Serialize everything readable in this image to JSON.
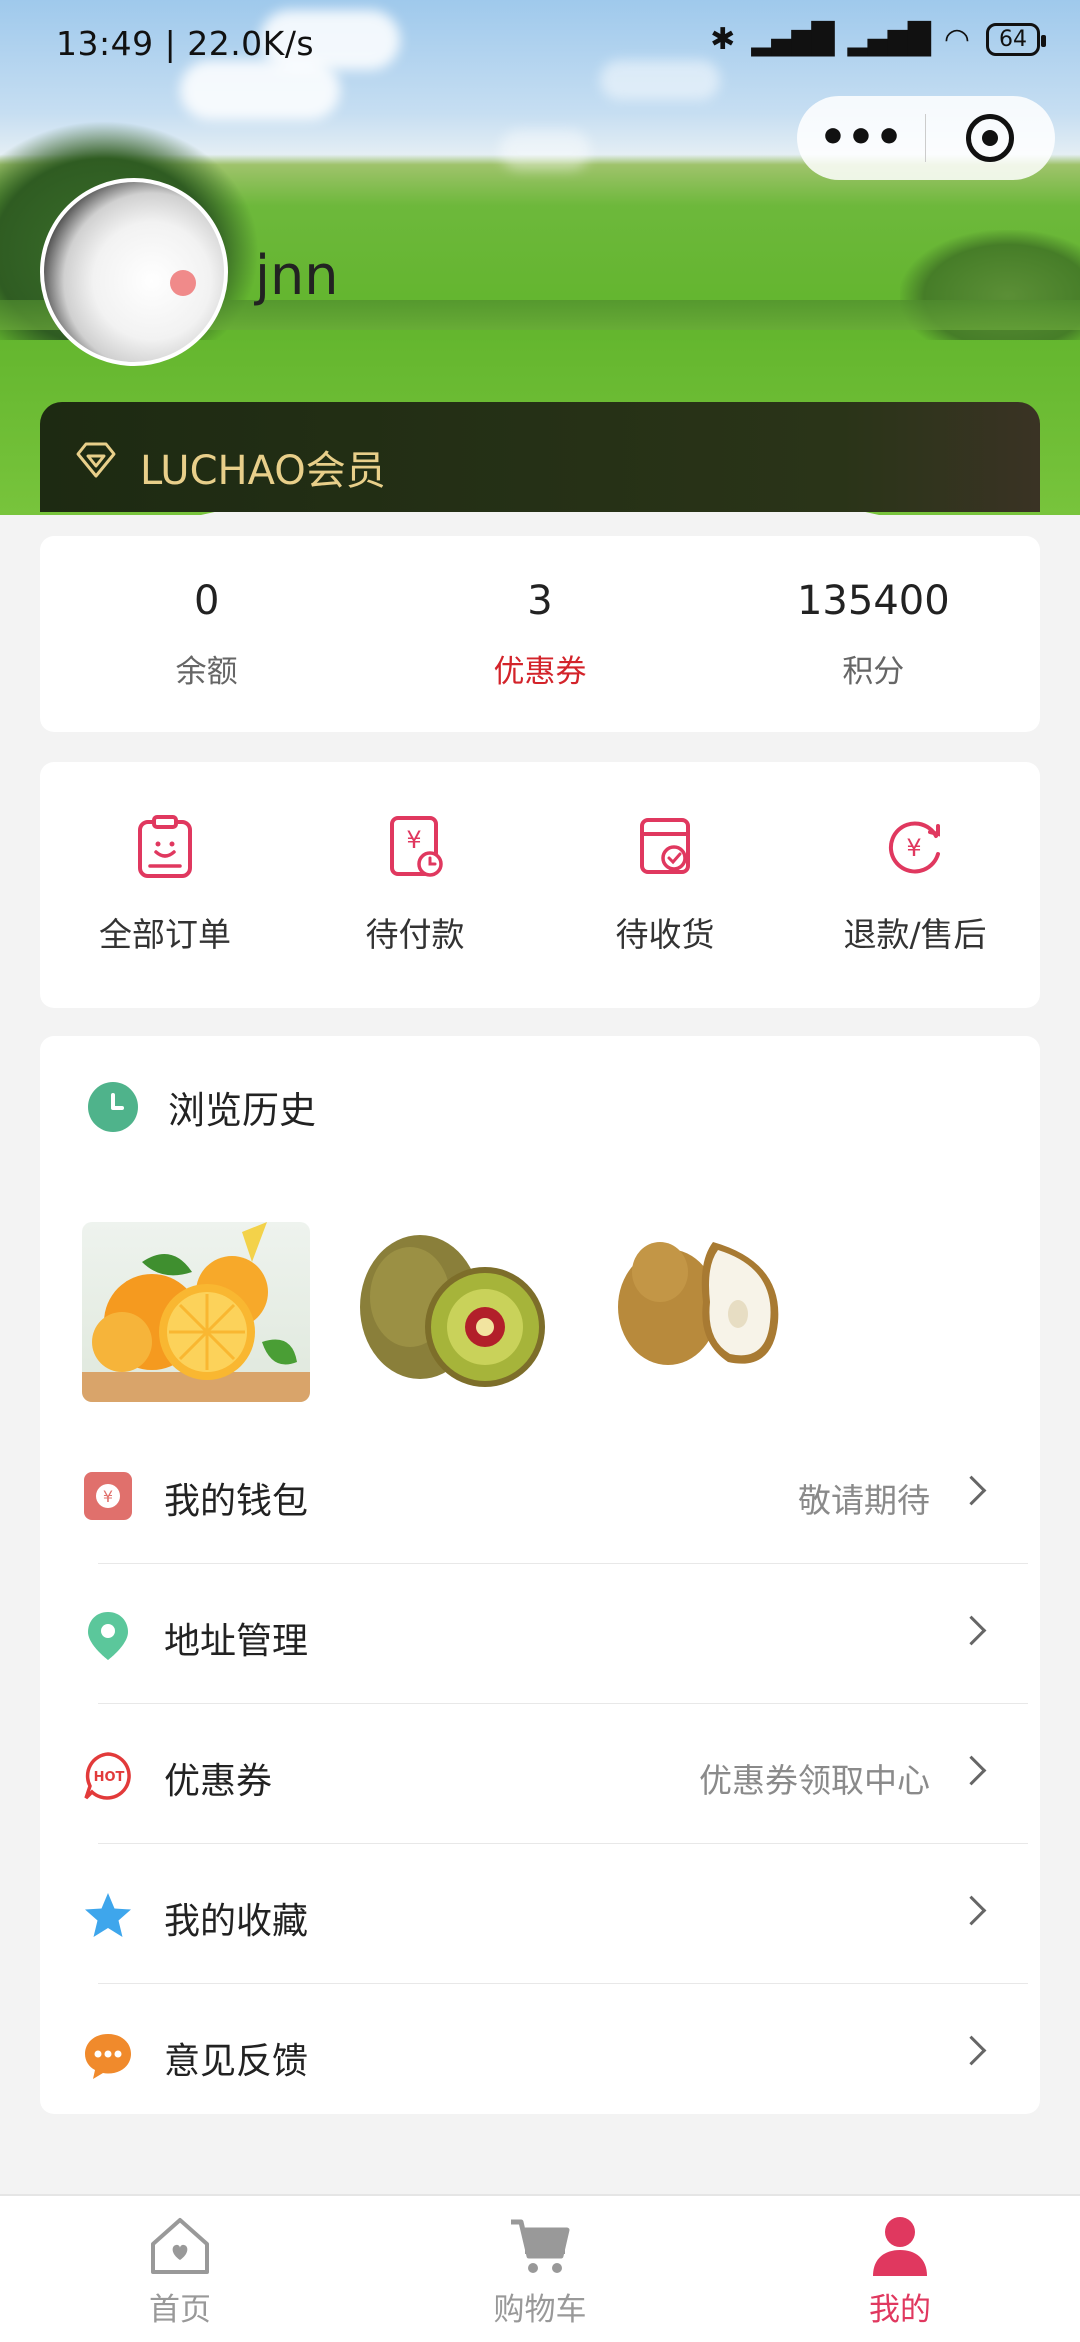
{
  "status_bar": {
    "time_speed": "13:49 | 22.0K/s",
    "battery": "64"
  },
  "profile": {
    "username": "jnn",
    "member_label": "LUCHAO会员"
  },
  "stats": [
    {
      "value": "0",
      "label": "余额"
    },
    {
      "value": "3",
      "label": "优惠券"
    },
    {
      "value": "135400",
      "label": "积分"
    }
  ],
  "orders": [
    {
      "label": "全部订单",
      "icon": "order-list-icon"
    },
    {
      "label": "待付款",
      "icon": "pending-payment-icon"
    },
    {
      "label": "待收货",
      "icon": "pending-receipt-icon"
    },
    {
      "label": "退款/售后",
      "icon": "refund-icon"
    }
  ],
  "history": {
    "title": "浏览历史",
    "items": [
      "orange",
      "kiwi",
      "pear"
    ]
  },
  "menu": [
    {
      "label": "我的钱包",
      "sub": "敬请期待",
      "icon": "wallet-icon",
      "color": "#e0706c"
    },
    {
      "label": "地址管理",
      "sub": "",
      "icon": "location-pin-icon",
      "color": "#5bc79b"
    },
    {
      "label": "优惠券",
      "sub": "优惠券领取中心",
      "icon": "hot-coupon-icon",
      "color": "#e23a3a"
    },
    {
      "label": "我的收藏",
      "sub": "",
      "icon": "star-icon",
      "color": "#3ea6ec"
    },
    {
      "label": "意见反馈",
      "sub": "",
      "icon": "feedback-chat-icon",
      "color": "#f08a2c"
    }
  ],
  "tabbar": [
    {
      "label": "首页",
      "icon": "home-icon"
    },
    {
      "label": "购物车",
      "icon": "cart-icon"
    },
    {
      "label": "我的",
      "icon": "user-icon"
    }
  ],
  "colors": {
    "accent_pink": "#e0385f",
    "coupon_red": "#d3232a",
    "member_gold": "#e8cf8a"
  }
}
